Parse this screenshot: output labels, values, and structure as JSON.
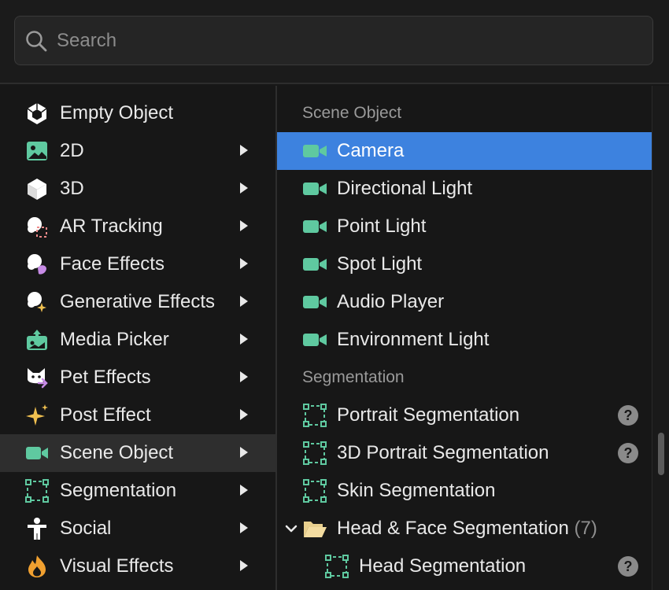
{
  "search": {
    "placeholder": "Search",
    "value": ""
  },
  "categories": [
    {
      "label": "Empty Object",
      "icon": "cube-outline-icon",
      "has_submenu": false
    },
    {
      "label": "2D",
      "icon": "image-icon",
      "has_submenu": true
    },
    {
      "label": "3D",
      "icon": "cube-icon",
      "has_submenu": true
    },
    {
      "label": "AR Tracking",
      "icon": "ar-tracking-icon",
      "has_submenu": true
    },
    {
      "label": "Face Effects",
      "icon": "face-effects-icon",
      "has_submenu": true
    },
    {
      "label": "Generative Effects",
      "icon": "generative-effects-icon",
      "has_submenu": true
    },
    {
      "label": "Media Picker",
      "icon": "media-picker-icon",
      "has_submenu": true
    },
    {
      "label": "Pet Effects",
      "icon": "pet-effects-icon",
      "has_submenu": true
    },
    {
      "label": "Post Effect",
      "icon": "sparkle-icon",
      "has_submenu": true
    },
    {
      "label": "Scene Object",
      "icon": "video-camera-icon",
      "has_submenu": true,
      "active": true
    },
    {
      "label": "Segmentation",
      "icon": "segmentation-icon",
      "has_submenu": true
    },
    {
      "label": "Social",
      "icon": "person-icon",
      "has_submenu": true
    },
    {
      "label": "Visual Effects",
      "icon": "flame-icon",
      "has_submenu": true
    }
  ],
  "submenu": {
    "scene_header": "Scene Object",
    "scene_items": [
      {
        "label": "Camera",
        "icon": "video-camera-icon",
        "selected": true
      },
      {
        "label": "Directional Light",
        "icon": "video-camera-icon"
      },
      {
        "label": "Point Light",
        "icon": "video-camera-icon"
      },
      {
        "label": "Spot Light",
        "icon": "video-camera-icon"
      },
      {
        "label": "Audio Player",
        "icon": "video-camera-icon"
      },
      {
        "label": "Environment Light",
        "icon": "video-camera-icon"
      }
    ],
    "seg_header": "Segmentation",
    "seg_items": [
      {
        "label": "Portrait Segmentation",
        "icon": "segmentation-icon",
        "help": "?"
      },
      {
        "label": "3D Portrait Segmentation",
        "icon": "segmentation-icon",
        "help": "?"
      },
      {
        "label": "Skin Segmentation",
        "icon": "segmentation-icon"
      }
    ],
    "folder": {
      "label": "Head & Face Segmentation",
      "count": "(7)",
      "icon": "folder-open-icon"
    },
    "folder_children": [
      {
        "label": "Head Segmentation",
        "icon": "segmentation-icon",
        "help": "?"
      }
    ]
  },
  "colors": {
    "accent_selected": "#3d82df",
    "icon_green": "#5fc9a0",
    "background": "#171717"
  }
}
